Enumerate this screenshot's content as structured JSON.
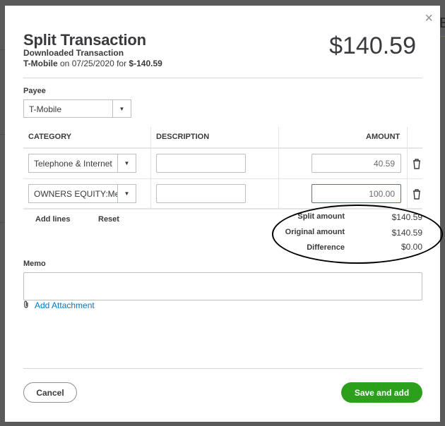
{
  "background": {
    "partial_text": "B"
  },
  "dialog": {
    "title": "Split Transaction",
    "subtitle": "Downloaded Transaction",
    "payee_name": "T-Mobile",
    "on_text": " on 07/25/2020 for ",
    "amount_text": "$-140.59",
    "total_amount": "$140.59",
    "close_icon": "×"
  },
  "payee": {
    "label": "Payee",
    "value": "T-Mobile"
  },
  "table": {
    "headers": {
      "category": "CATEGORY",
      "description": "DESCRIPTION",
      "amount": "AMOUNT"
    },
    "rows": [
      {
        "category": "Telephone & Internet",
        "description": "",
        "amount": "40.59"
      },
      {
        "category": "OWNERS EQUITY:Me",
        "description": "",
        "amount": "100.00"
      }
    ]
  },
  "actions": {
    "add_lines": "Add lines",
    "reset": "Reset"
  },
  "summary": {
    "split_label": "Split amount",
    "split_value": "$140.59",
    "original_label": "Original amount",
    "original_value": "$140.59",
    "difference_label": "Difference",
    "difference_value": "$0.00"
  },
  "memo": {
    "label": "Memo",
    "value": ""
  },
  "attachment": {
    "label": "Add Attachment"
  },
  "footer": {
    "cancel": "Cancel",
    "save": "Save and add"
  },
  "colors": {
    "accent_green": "#2ca01c",
    "link_blue": "#0077c5"
  }
}
